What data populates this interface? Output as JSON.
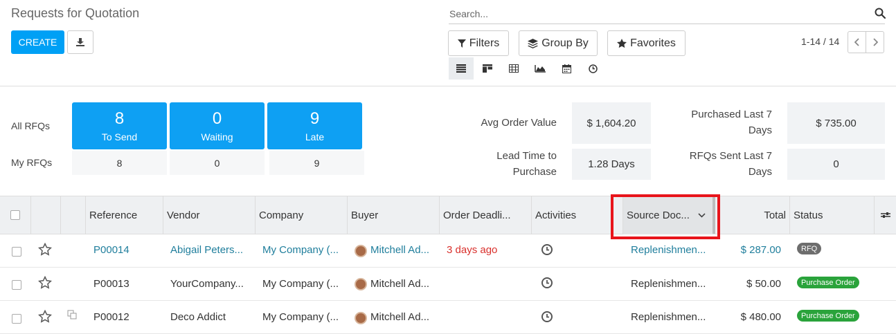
{
  "page": {
    "title": "Requests for Quotation"
  },
  "toolbar": {
    "create_label": "CREATE",
    "download_icon": "download-icon"
  },
  "search": {
    "placeholder": "Search..."
  },
  "facets": {
    "filters": "Filters",
    "group_by": "Group By",
    "favorites": "Favorites"
  },
  "pager": {
    "text": "1-14 / 14"
  },
  "views": [
    "list-view",
    "kanban-view",
    "pivot-view",
    "graph-view",
    "calendar-view",
    "activity-view"
  ],
  "dashboard": {
    "all_label": "All RFQs",
    "my_label": "My RFQs",
    "tiles": [
      {
        "num": "8",
        "label": "To Send",
        "mine": "8"
      },
      {
        "num": "0",
        "label": "Waiting",
        "mine": "0"
      },
      {
        "num": "9",
        "label": "Late",
        "mine": "9"
      }
    ],
    "stats": {
      "avg_order_label": "Avg Order Value",
      "avg_order_value": "$ 1,604.20",
      "purchased_label_1": "Purchased Last 7",
      "purchased_label_2": "Days",
      "purchased_value": "$ 735.00",
      "lead_label_1": "Lead Time to",
      "lead_label_2": "Purchase",
      "lead_value": "1.28 Days",
      "rfq_sent_label_1": "RFQs Sent Last 7",
      "rfq_sent_label_2": "Days",
      "rfq_sent_value": "0"
    }
  },
  "table": {
    "headers": {
      "reference": "Reference",
      "vendor": "Vendor",
      "company": "Company",
      "buyer": "Buyer",
      "deadline": "Order Deadli...",
      "activities": "Activities",
      "source": "Source Doc...",
      "total": "Total",
      "status": "Status"
    },
    "rows": [
      {
        "ref": "P00014",
        "vendor": "Abigail Peters...",
        "company": "My Company (...",
        "buyer": "Mitchell Ad...",
        "deadline": "3 days ago",
        "source": "Replenishmen...",
        "total": "$ 287.00",
        "status": "RFQ"
      },
      {
        "ref": "P00013",
        "vendor": "YourCompany...",
        "company": "My Company (...",
        "buyer": "Mitchell Ad...",
        "deadline": "",
        "source": "Replenishmen...",
        "total": "$ 50.00",
        "status": "Purchase Order"
      },
      {
        "ref": "P00012",
        "vendor": "Deco Addict",
        "company": "My Company (...",
        "buyer": "Mitchell Ad...",
        "deadline": "",
        "source": "Replenishmen...",
        "total": "$ 480.00",
        "status": "Purchase Order"
      }
    ]
  },
  "colors": {
    "accent": "#00a0f5",
    "highlight": "#e8141b",
    "po_badge": "#2aa33b",
    "rfq_badge": "#6d6d6d"
  }
}
